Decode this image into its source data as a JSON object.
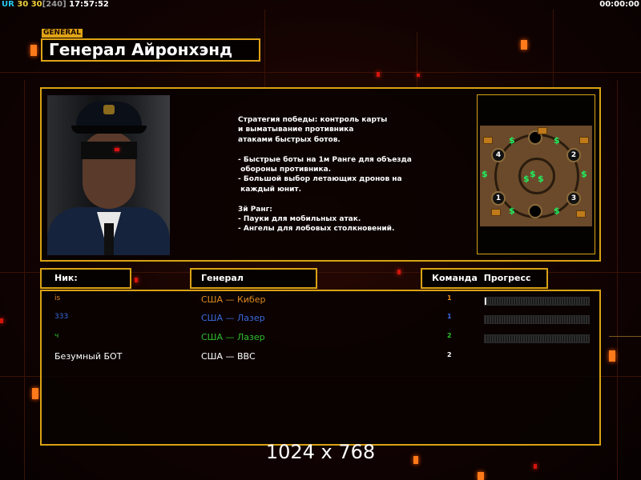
{
  "topbar": {
    "ur": "UR",
    "val1": "30",
    "val2": "30",
    "bracket": "[240]",
    "clock": "17:57:52",
    "timer": "00:00:00"
  },
  "general": {
    "tag": "GENERAL",
    "name": "Генерал Айронхэнд",
    "strategy_lines": [
      "Стратегия победы: контроль карты",
      "и выматывание противника",
      "атаками быстрых ботов.",
      "",
      "- Быстрые боты на 1м Ранге для объезда",
      " обороны противника.",
      "- Большой выбор летающих дронов на",
      " каждый юнит.",
      "",
      "3й Ранг:",
      "- Пауки для мобильных атак.",
      "- Ангелы для лобовых столкновений."
    ]
  },
  "map": {
    "bases": [
      "1",
      "2",
      "3",
      "4"
    ],
    "cash_symbol": "$"
  },
  "table": {
    "headers": {
      "nick": "Ник:",
      "general": "Генерал",
      "team": "Команда",
      "progress": "Прогресс"
    },
    "rows": [
      {
        "nick": "is",
        "nick_color": "#e08a1e",
        "general": "США — Кибер",
        "general_color": "#e08a1e",
        "team": "1",
        "team_color": "#e08a1e",
        "progress": 0.01
      },
      {
        "nick": "333",
        "nick_color": "#3a6ae0",
        "general": "США — Лазер",
        "general_color": "#3a6ae0",
        "team": "1",
        "team_color": "#3a6ae0",
        "progress": 0
      },
      {
        "nick": "ч",
        "nick_color": "#2ec02e",
        "general": "США — Лазер",
        "general_color": "#2ec02e",
        "team": "2",
        "team_color": "#2ec02e",
        "progress": 0
      },
      {
        "nick": "Безумный БОТ",
        "nick_color": "#ffffff",
        "general": "США — ВВС",
        "general_color": "#ffffff",
        "team": "2",
        "team_color": "#ffffff",
        "progress": null
      }
    ]
  },
  "resolution": "1024 x 768",
  "colors": {
    "accent": "#d9a214",
    "background": "#0b0302"
  }
}
